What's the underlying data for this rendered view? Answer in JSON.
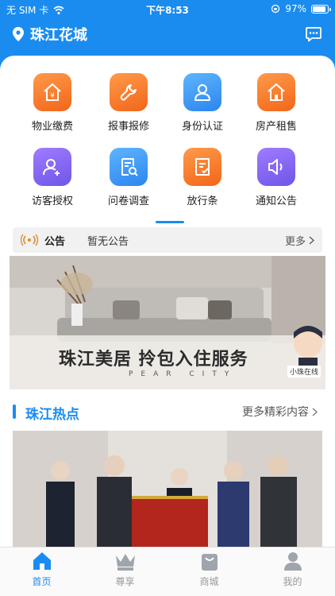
{
  "status_bar": {
    "carrier": "无 SIM 卡",
    "time": "下午8:53",
    "battery_text": "97%",
    "battery_level": 0.97
  },
  "header": {
    "community": "珠江花城"
  },
  "grid": [
    {
      "label": "物业缴费",
      "icon": "property-fee-icon",
      "color": "orange"
    },
    {
      "label": "报事报修",
      "icon": "repair-wrench-icon",
      "color": "orange"
    },
    {
      "label": "身份认证",
      "icon": "person-id-icon",
      "color": "blue"
    },
    {
      "label": "房产租售",
      "icon": "house-icon",
      "color": "orange"
    },
    {
      "label": "访客授权",
      "icon": "add-user-icon",
      "color": "purple"
    },
    {
      "label": "问卷调查",
      "icon": "survey-search-icon",
      "color": "blue"
    },
    {
      "label": "放行条",
      "icon": "pass-slip-icon",
      "color": "orange"
    },
    {
      "label": "通知公告",
      "icon": "speaker-icon",
      "color": "purple"
    }
  ],
  "notice": {
    "title": "公告",
    "content": "暂无公告",
    "more": "更多"
  },
  "banner": {
    "caption": "珠江美居 拎包入住服务",
    "subtitle": "PEAR CITY",
    "badge": "小珠在线"
  },
  "hot_section": {
    "title": "珠江热点",
    "more": "更多精彩内容"
  },
  "tabs": [
    {
      "label": "首页",
      "icon": "home-icon",
      "active": true
    },
    {
      "label": "尊享",
      "icon": "crown-icon",
      "active": false
    },
    {
      "label": "商城",
      "icon": "shopping-bag-icon",
      "active": false
    },
    {
      "label": "我的",
      "icon": "profile-icon",
      "active": false
    }
  ],
  "colors": {
    "primary": "#1a8cf0",
    "orange": "#f2661a",
    "purple": "#6f55e8"
  }
}
